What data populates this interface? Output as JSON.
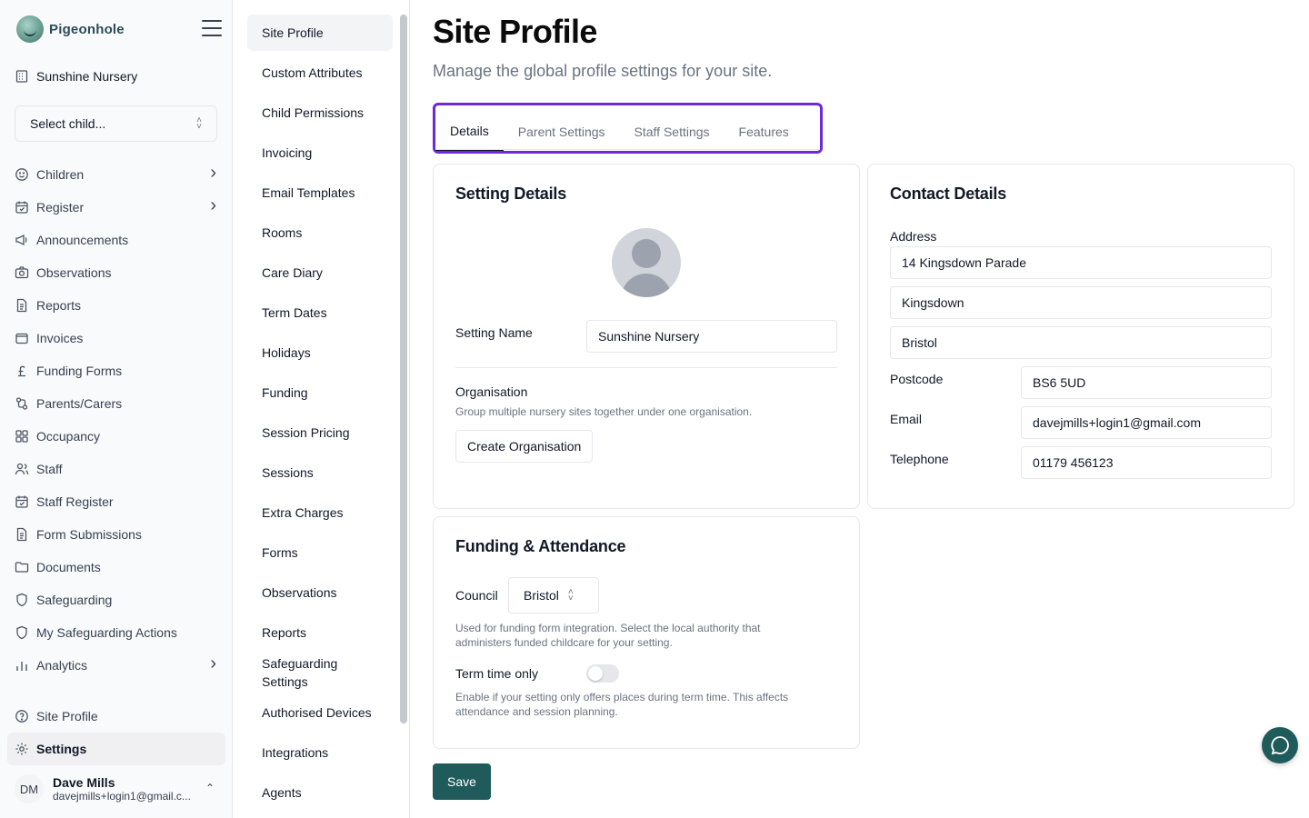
{
  "brand": {
    "name": "Pigeonhole",
    "logo_icon": "pigeon-logo-icon"
  },
  "site": {
    "name": "Sunshine Nursery"
  },
  "child_select": {
    "value": "Select child..."
  },
  "nav": {
    "items": [
      {
        "label": "Children",
        "icon": "smile-icon",
        "chevron": true
      },
      {
        "label": "Register",
        "icon": "calendar-check-icon",
        "chevron": true
      },
      {
        "label": "Announcements",
        "icon": "megaphone-icon",
        "chevron": false
      },
      {
        "label": "Observations",
        "icon": "camera-icon",
        "chevron": false
      },
      {
        "label": "Reports",
        "icon": "file-text-icon",
        "chevron": false
      },
      {
        "label": "Invoices",
        "icon": "wallet-icon",
        "chevron": false
      },
      {
        "label": "Funding Forms",
        "icon": "pound-icon",
        "chevron": false
      },
      {
        "label": "Parents/Carers",
        "icon": "users-link-icon",
        "chevron": false
      },
      {
        "label": "Occupancy",
        "icon": "grid-icon",
        "chevron": false
      },
      {
        "label": "Staff",
        "icon": "staff-icon",
        "chevron": false
      },
      {
        "label": "Staff Register",
        "icon": "calendar-check-icon",
        "chevron": false
      },
      {
        "label": "Form Submissions",
        "icon": "file-text-icon",
        "chevron": false
      },
      {
        "label": "Documents",
        "icon": "folder-icon",
        "chevron": false
      },
      {
        "label": "Safeguarding",
        "icon": "shield-icon",
        "chevron": false
      },
      {
        "label": "My Safeguarding Actions",
        "icon": "shield-icon",
        "chevron": false
      },
      {
        "label": "Analytics",
        "icon": "bar-chart-icon",
        "chevron": true
      }
    ],
    "bottom": [
      {
        "label": "Site Profile",
        "icon": "help-circle-icon"
      },
      {
        "label": "Settings",
        "icon": "gear-icon"
      }
    ]
  },
  "user": {
    "initials": "DM",
    "name": "Dave Mills",
    "email": "davejmills+login1@gmail.c..."
  },
  "subnav": {
    "items": [
      "Site Profile",
      "Custom Attributes",
      "Child Permissions",
      "Invoicing",
      "Email Templates",
      "Rooms",
      "Care Diary",
      "Term Dates",
      "Holidays",
      "Funding",
      "Session Pricing",
      "Sessions",
      "Extra Charges",
      "Forms",
      "Observations",
      "Reports",
      "Safeguarding Settings",
      "Authorised Devices",
      "Integrations",
      "Agents"
    ]
  },
  "page": {
    "title": "Site Profile",
    "subtitle": "Manage the global profile settings for your site.",
    "tabs": [
      "Details",
      "Parent Settings",
      "Staff Settings",
      "Features"
    ]
  },
  "setting_details": {
    "title": "Setting Details",
    "name_label": "Setting Name",
    "name_value": "Sunshine Nursery",
    "org_label": "Organisation",
    "org_help": "Group multiple nursery sites together under one organisation.",
    "org_button": "Create Organisation"
  },
  "contact_details": {
    "title": "Contact Details",
    "address_label": "Address",
    "address_line1": "14 Kingsdown Parade",
    "address_line2": "Kingsdown",
    "address_line3": "Bristol",
    "postcode_label": "Postcode",
    "postcode_value": "BS6 5UD",
    "email_label": "Email",
    "email_value": "davejmills+login1@gmail.com",
    "telephone_label": "Telephone",
    "telephone_value": "01179 456123"
  },
  "funding": {
    "title": "Funding & Attendance",
    "council_label": "Council",
    "council_value": "Bristol",
    "council_help": "Used for funding form integration. Select the local authority that administers funded childcare for your setting.",
    "term_label": "Term time only",
    "term_on": false,
    "term_help": "Enable if your setting only offers places during term time. This affects attendance and session planning."
  },
  "actions": {
    "save": "Save"
  },
  "colors": {
    "primary": "#1f5b5b",
    "tab_highlight": "#6d28d9"
  }
}
